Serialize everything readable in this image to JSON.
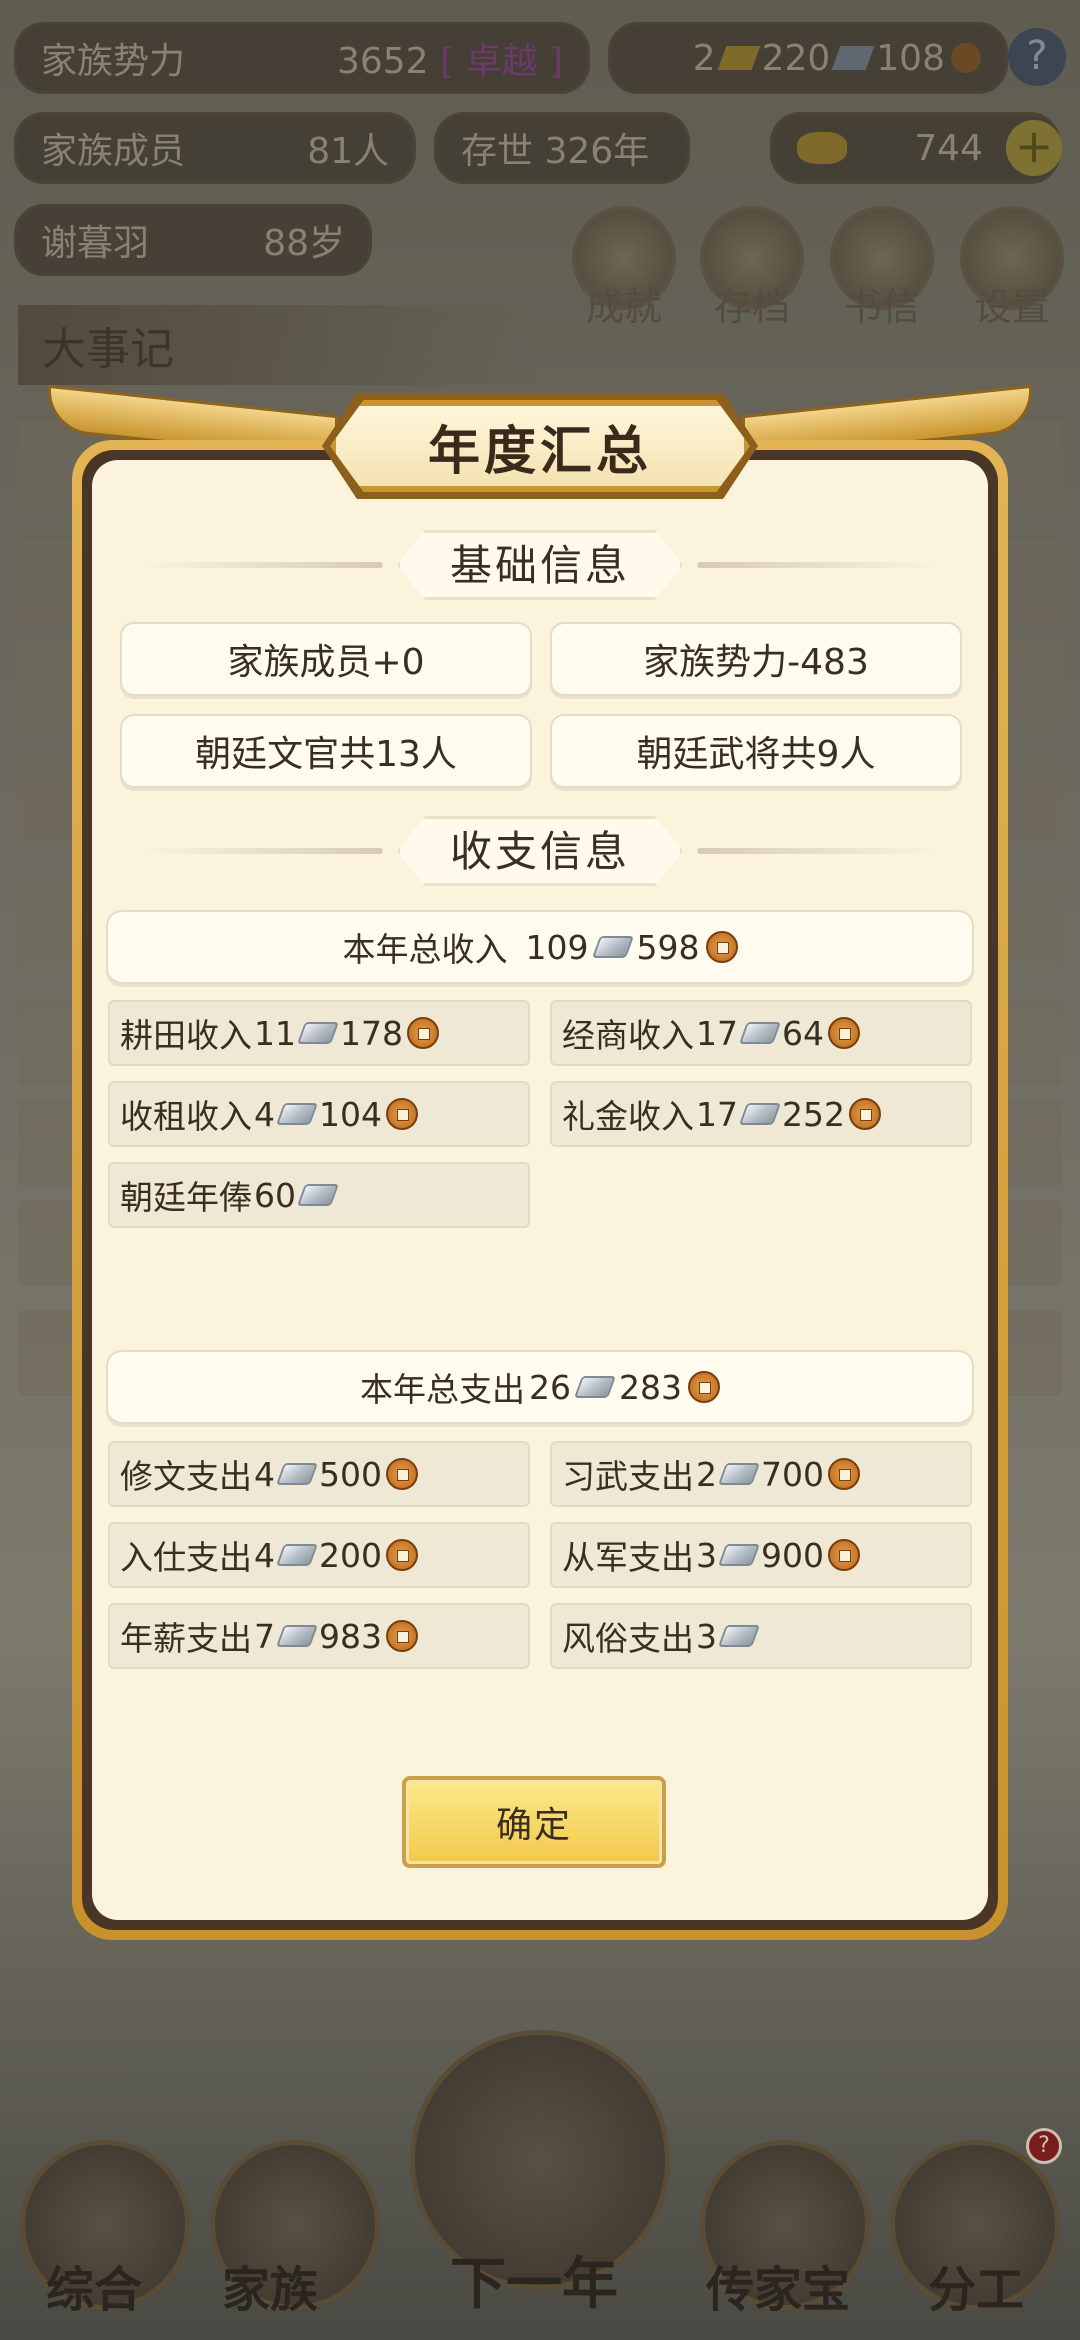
{
  "background": {
    "power_label": "家族势力",
    "power_value": "3652",
    "power_rank": "[ 卓越 ]",
    "currency_gold": "2",
    "currency_silver": "220",
    "currency_coin": "108",
    "members_label": "家族成员",
    "members_value": "81人",
    "existence": "存世  326年",
    "ingot_value": "744",
    "patriarch_name": "谢暮羽",
    "patriarch_age": "88岁",
    "menu": [
      "成就",
      "存档",
      "书信",
      "设置"
    ],
    "events_title": "大事记",
    "bottom_nav": [
      "综合",
      "家族",
      "下一年",
      "传家宝",
      "分工"
    ],
    "notification_badge": "?"
  },
  "modal": {
    "title": "年度汇总",
    "basic_section": "基础信息",
    "basic": {
      "members_change": "家族成员+0",
      "power_change": "家族势力-483",
      "civil_officials": "朝廷文官共13人",
      "military_generals": "朝廷武将共9人"
    },
    "finance_section": "收支信息",
    "income_total": {
      "label": "本年总收入",
      "silver": "109",
      "coin": "598"
    },
    "income_items": [
      {
        "label": "耕田收入",
        "silver": "11",
        "coin": "178"
      },
      {
        "label": "经商收入",
        "silver": "17",
        "coin": "64"
      },
      {
        "label": "收租收入",
        "silver": "4",
        "coin": "104"
      },
      {
        "label": "礼金收入",
        "silver": "17",
        "coin": "252"
      },
      {
        "label": "朝廷年俸",
        "silver": "60",
        "coin": ""
      }
    ],
    "expense_total": {
      "label": "本年总支出",
      "silver": "26",
      "coin": "283"
    },
    "expense_items": [
      {
        "label": "修文支出",
        "silver": "4",
        "coin": "500"
      },
      {
        "label": "习武支出",
        "silver": "2",
        "coin": "700"
      },
      {
        "label": "入仕支出",
        "silver": "4",
        "coin": "200"
      },
      {
        "label": "从军支出",
        "silver": "3",
        "coin": "900"
      },
      {
        "label": "年薪支出",
        "silver": "7",
        "coin": "983"
      },
      {
        "label": "风俗支出",
        "silver": "3",
        "coin": ""
      }
    ],
    "confirm_label": "确定"
  }
}
